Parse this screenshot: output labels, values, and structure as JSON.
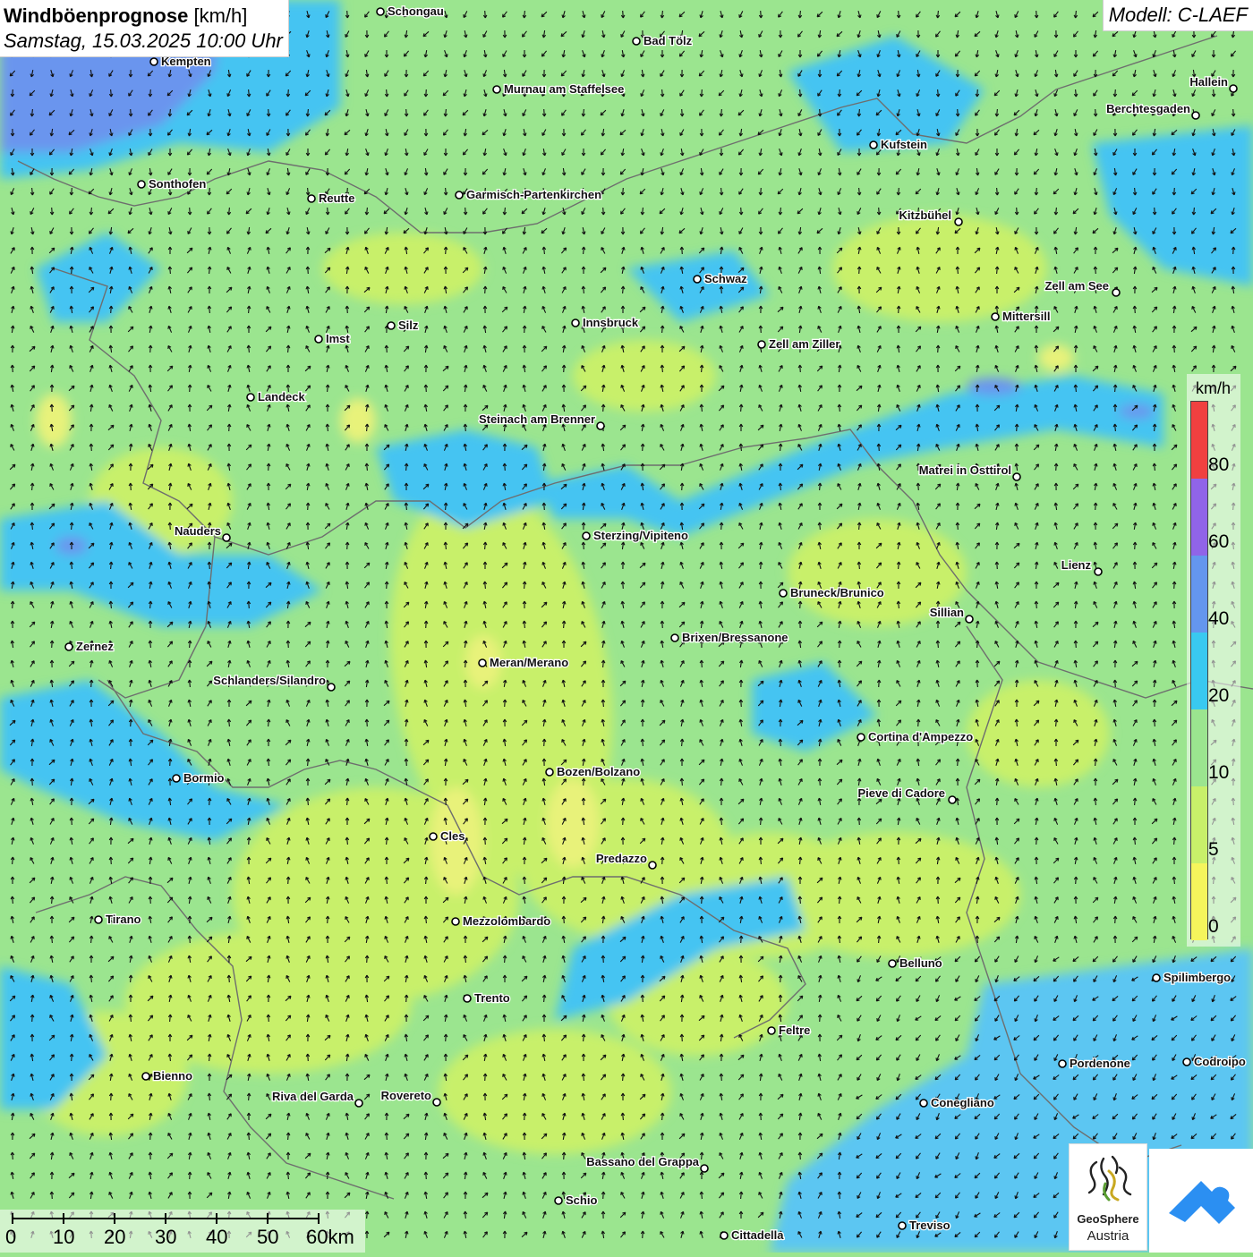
{
  "header": {
    "title": "Windböenprognose",
    "unit": "[km/h]",
    "datetime": "Samstag, 15.03.2025 10:00 Uhr"
  },
  "model": {
    "label": "Modell: C-LAEF"
  },
  "legend": {
    "unit": "km/h",
    "labels": [
      "0",
      "5",
      "10",
      "20",
      "40",
      "60",
      "80"
    ],
    "colors": [
      "#f5f55c",
      "#c8f06a",
      "#9be58f",
      "#39c9f0",
      "#6496ee",
      "#9064e8",
      "#f04040",
      "#ee2a2a"
    ]
  },
  "scalebar": {
    "labels": [
      "0",
      "10",
      "20",
      "30",
      "40",
      "50",
      "60km"
    ]
  },
  "logos": {
    "geosphere_line1": "GeoSphere",
    "geosphere_line2": "Austria",
    "geosphere_icon": "geosphere-logo-icon",
    "app_icon": "wetter-app-logo-icon"
  },
  "map_colors": {
    "base": "#9be58f",
    "light": "#c8f06a",
    "yellow": "#e8f27a",
    "blue": "#45c4f2",
    "deep_blue": "#6a95ee",
    "sea": "#5bc6f2",
    "border": "#6e6e6e"
  },
  "places": [
    {
      "name": "Schongau"
    },
    {
      "name": "Kempten"
    },
    {
      "name": "Bad Tölz"
    },
    {
      "name": "Murnau am Staffelsee"
    },
    {
      "name": "Hallein"
    },
    {
      "name": "Berchtesgaden"
    },
    {
      "name": "Kufstein"
    },
    {
      "name": "Sonthofen"
    },
    {
      "name": "Reutte"
    },
    {
      "name": "Garmisch-Partenkirchen"
    },
    {
      "name": "Kitzbühel"
    },
    {
      "name": "Schwaz"
    },
    {
      "name": "Zell am See"
    },
    {
      "name": "Innsbruck"
    },
    {
      "name": "Mittersill"
    },
    {
      "name": "Silz"
    },
    {
      "name": "Imst"
    },
    {
      "name": "Zell am Ziller"
    },
    {
      "name": "Landeck"
    },
    {
      "name": "Steinach am Brenner"
    },
    {
      "name": "Matrei in Osttirol"
    },
    {
      "name": "Nauders"
    },
    {
      "name": "Sterzing/Vipiteno"
    },
    {
      "name": "Lienz"
    },
    {
      "name": "Bruneck/Brunico"
    },
    {
      "name": "Sillian"
    },
    {
      "name": "Zernez"
    },
    {
      "name": "Brixen/Bressanone"
    },
    {
      "name": "Meran/Merano"
    },
    {
      "name": "Schlanders/Silandro"
    },
    {
      "name": "Cortina d'Ampezzo"
    },
    {
      "name": "Bormio"
    },
    {
      "name": "Bozen/Bolzano"
    },
    {
      "name": "Pieve di Cadore"
    },
    {
      "name": "Cles"
    },
    {
      "name": "Predazzo"
    },
    {
      "name": "Tirano"
    },
    {
      "name": "Mezzolombardo"
    },
    {
      "name": "Belluno"
    },
    {
      "name": "Spilimbergo"
    },
    {
      "name": "Trento"
    },
    {
      "name": "Feltre"
    },
    {
      "name": "Pordenone"
    },
    {
      "name": "Codroipo"
    },
    {
      "name": "Bienno"
    },
    {
      "name": "Riva del Garda"
    },
    {
      "name": "Rovereto"
    },
    {
      "name": "Conegliano"
    },
    {
      "name": "Bassano del Grappa"
    },
    {
      "name": "Schio"
    },
    {
      "name": "Treviso"
    },
    {
      "name": "Cittadella"
    }
  ]
}
